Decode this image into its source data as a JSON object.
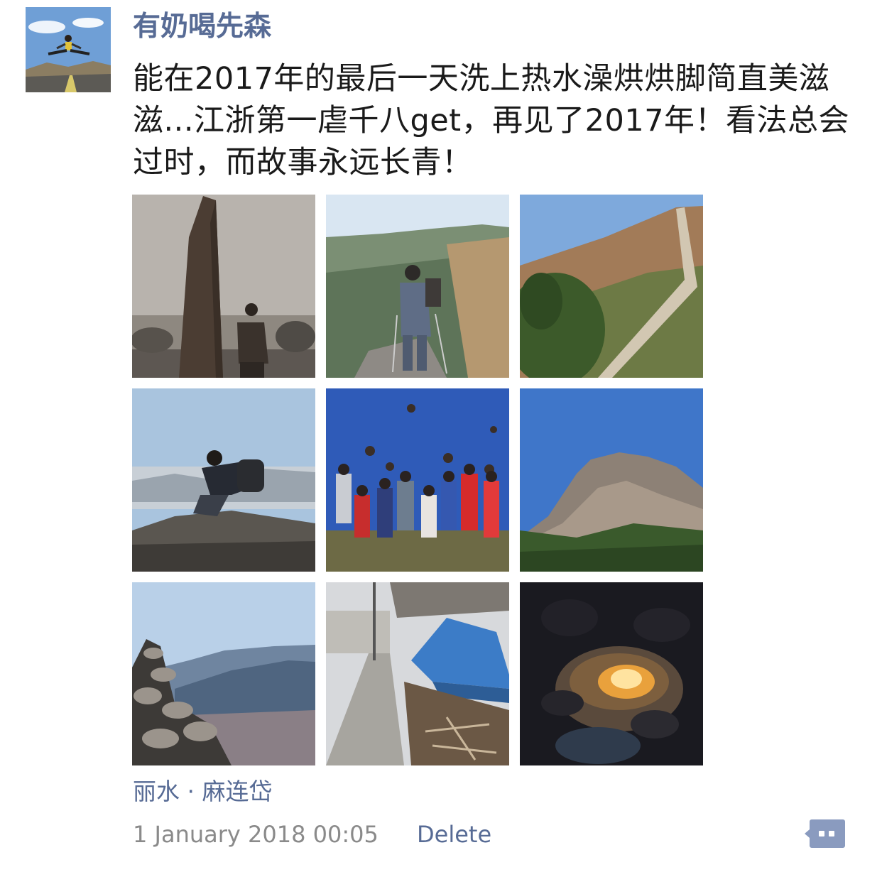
{
  "post": {
    "username": "有奶喝先森",
    "avatar_icon": "avatar-photo",
    "text": "能在2017年的最后一天洗上热水澡烘烘脚简直美滋滋...江浙第一虐千八get，再见了2017年！看法总会过时，而故事永远长青！",
    "photos": [
      {
        "icon": "monument-photo"
      },
      {
        "icon": "hiker-on-trail-photo"
      },
      {
        "icon": "mountain-ridge-photo"
      },
      {
        "icon": "hiker-resting-photo"
      },
      {
        "icon": "group-jump-photo"
      },
      {
        "icon": "rocky-peak-photo"
      },
      {
        "icon": "stone-cairn-photo"
      },
      {
        "icon": "village-tent-photo"
      },
      {
        "icon": "campfire-photo"
      }
    ],
    "location": "丽水 · 麻连岱",
    "timestamp": "1 January 2018 00:05",
    "delete_label": "Delete",
    "comment_icon": "comment-icon"
  },
  "colors": {
    "link": "#576b95",
    "text": "#1a1a1a",
    "meta": "#8a8a8a",
    "comment_button": "#8a9bbf"
  }
}
